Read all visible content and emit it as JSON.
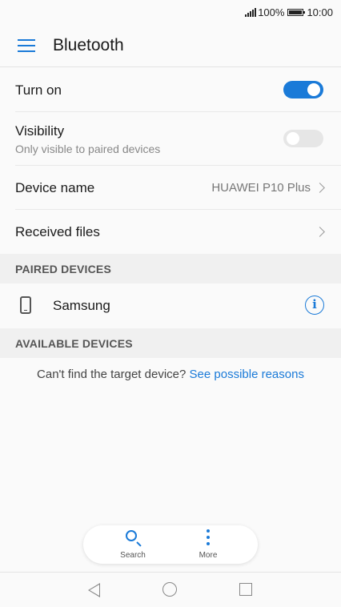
{
  "status_bar": {
    "battery_text": "100%",
    "time": "10:00"
  },
  "app_bar": {
    "title": "Bluetooth"
  },
  "settings": {
    "turn_on": {
      "label": "Turn on",
      "enabled": true
    },
    "visibility": {
      "label": "Visibility",
      "subtitle": "Only visible to paired devices",
      "enabled": false
    },
    "device_name": {
      "label": "Device name",
      "value": "HUAWEI P10 Plus"
    },
    "received_files": {
      "label": "Received files"
    }
  },
  "paired_devices": {
    "header": "PAIRED DEVICES",
    "items": [
      {
        "name": "Samsung"
      }
    ]
  },
  "available_devices": {
    "header": "AVAILABLE DEVICES",
    "hint_text": "Can't find the target device?",
    "hint_link": "See possible reasons"
  },
  "bottom_actions": {
    "search_label": "Search",
    "more_label": "More"
  },
  "colors": {
    "accent": "#1a7ad8",
    "toggle_off": "#e6e6e6"
  }
}
